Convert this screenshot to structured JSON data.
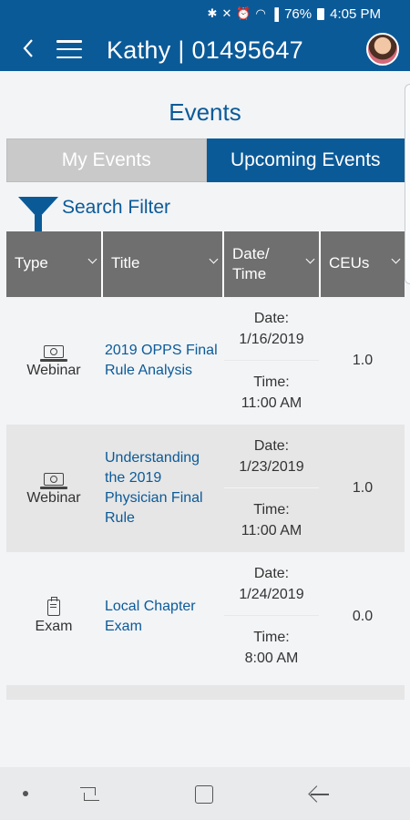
{
  "status_bar": {
    "battery": "76%",
    "time": "4:05 PM",
    "icons": [
      "bluetooth-icon",
      "mute-icon",
      "alarm-icon",
      "wifi-icon",
      "signal-icon",
      "battery-icon"
    ]
  },
  "header": {
    "title": "Kathy | 01495647",
    "back_icon": "back-arrow-icon",
    "menu_icon": "hamburger-menu-icon",
    "avatar": "user-avatar"
  },
  "page": {
    "title": "Events"
  },
  "tabs": [
    {
      "label": "My Events",
      "active": false
    },
    {
      "label": "Upcoming Events",
      "active": true
    }
  ],
  "filter": {
    "label": "Search Filter",
    "icon": "funnel-icon"
  },
  "table": {
    "columns": [
      {
        "label": "Type"
      },
      {
        "label": "Title"
      },
      {
        "label": "Date/ Time",
        "line1": "Date/",
        "line2": "Time"
      },
      {
        "label": "CEUs"
      }
    ],
    "rows": [
      {
        "type": "Webinar",
        "type_icon": "laptop-webinar-icon",
        "title": "2019 OPPS Final Rule Analysis",
        "date_label": "Date:",
        "date": "1/16/2019",
        "time_label": "Time:",
        "time": "11:00 AM",
        "ceus": "1.0"
      },
      {
        "type": "Webinar",
        "type_icon": "laptop-webinar-icon",
        "title": "Understanding the 2019 Physician Final Rule",
        "date_label": "Date:",
        "date": "1/23/2019",
        "time_label": "Time:",
        "time": "11:00 AM",
        "ceus": "1.0"
      },
      {
        "type": "Exam",
        "type_icon": "clipboard-exam-icon",
        "title": "Local Chapter Exam",
        "date_label": "Date:",
        "date": "1/24/2019",
        "time_label": "Time:",
        "time": "8:00 AM",
        "ceus": "0.0"
      }
    ]
  },
  "colors": {
    "brand_blue": "#0b5a98",
    "header_gray": "#6f6f6f",
    "row_alt": "#e6e6e6",
    "tab_inactive": "#c9c9c9"
  }
}
